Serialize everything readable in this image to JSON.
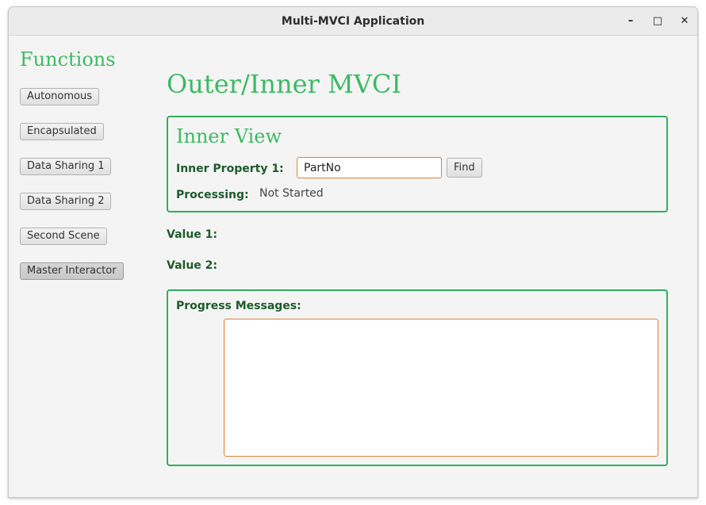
{
  "window": {
    "title": "Multi-MVCI Application",
    "controls": {
      "minimize": "–",
      "maximize": "□",
      "close": "✕"
    }
  },
  "sidebar": {
    "heading": "Functions",
    "items": [
      {
        "label": "Autonomous"
      },
      {
        "label": "Encapsulated"
      },
      {
        "label": "Data Sharing 1"
      },
      {
        "label": "Data Sharing 2"
      },
      {
        "label": "Second Scene"
      },
      {
        "label": "Master Interactor",
        "selected": true
      }
    ]
  },
  "main": {
    "title": "Outer/Inner MVCI",
    "inner_view": {
      "title": "Inner View",
      "property_label": "Inner Property 1:",
      "property_value": "PartNo",
      "find_label": "Find",
      "processing_label": "Processing:",
      "processing_value": "Not Started"
    },
    "value1_label": "Value 1:",
    "value2_label": "Value 2:",
    "progress": {
      "label": "Progress Messages:",
      "text": ""
    }
  },
  "colors": {
    "accent_green": "#3cba63",
    "border_green": "#2fae5c",
    "label_dark_green": "#1e5a2c",
    "focus_orange": "#e0822f"
  }
}
